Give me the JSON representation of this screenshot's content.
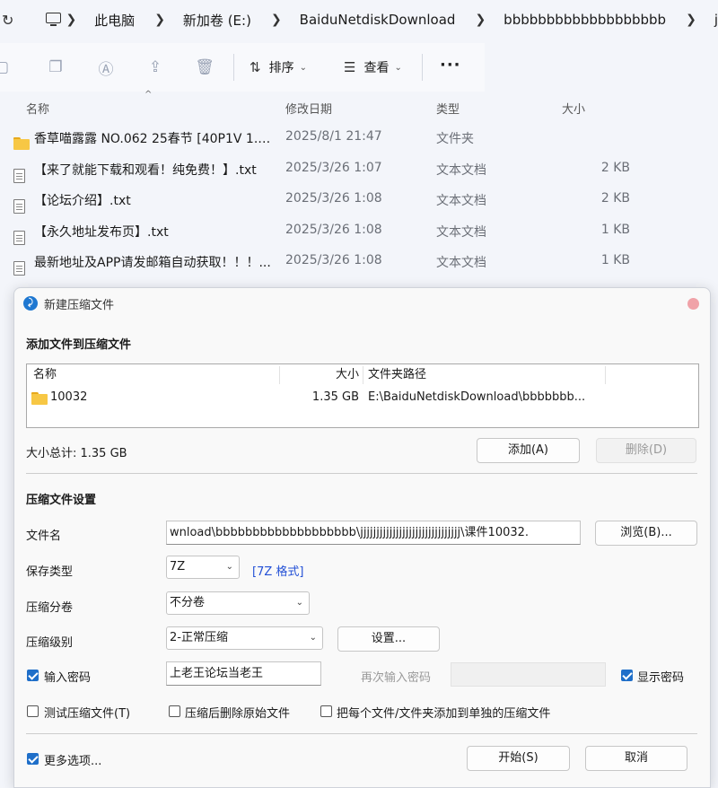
{
  "explorer": {
    "breadcrumb": [
      "此电脑",
      "新加卷 (E:)",
      "BaiduNetdiskDownload",
      "bbbbbbbbbbbbbbbbbbb",
      "j"
    ],
    "toolbar": {
      "sort_label": "排序",
      "view_label": "查看",
      "more_label": "···"
    },
    "columns": {
      "name": "名称",
      "date": "修改日期",
      "type": "类型",
      "size": "大小"
    },
    "files": [
      {
        "name": "香草喵露露 NO.062 25春节 [40P1V 1.3...",
        "date": "2025/8/1 21:47",
        "type": "文件夹",
        "size": "",
        "kind": "folder"
      },
      {
        "name": "【来了就能下载和观看！纯免费！】.txt",
        "date": "2025/3/26 1:07",
        "type": "文本文档",
        "size": "2 KB",
        "kind": "txt"
      },
      {
        "name": "【论坛介绍】.txt",
        "date": "2025/3/26 1:08",
        "type": "文本文档",
        "size": "2 KB",
        "kind": "txt"
      },
      {
        "name": "【永久地址发布页】.txt",
        "date": "2025/3/26 1:08",
        "type": "文本文档",
        "size": "1 KB",
        "kind": "txt"
      },
      {
        "name": "最新地址及APP请发邮箱自动获取！！！...",
        "date": "2025/3/26 1:08",
        "type": "文本文档",
        "size": "1 KB",
        "kind": "txt"
      }
    ]
  },
  "dialog": {
    "title": "新建压缩文件",
    "add_section_title": "添加文件到压缩文件",
    "table": {
      "col_name": "名称",
      "col_size": "大小",
      "col_path": "文件夹路径",
      "rows": [
        {
          "name": "10032",
          "size": "1.35 GB",
          "path": "E:\\BaiduNetdiskDownload\\bbbbbbb..."
        }
      ]
    },
    "total_size": "大小总计: 1.35 GB",
    "add_button": "添加(A)",
    "delete_button": "删除(D)",
    "settings_section_title": "压缩文件设置",
    "filename_label": "文件名",
    "filename_value": "wnload\\bbbbbbbbbbbbbbbbbbb\\jjjjjjjjjjjjjjjjjjjjjjjjjjjjjjj\\课件10032.",
    "browse_button": "浏览(B)...",
    "save_type_label": "保存类型",
    "save_type_value": "7Z",
    "format_link": "[7Z 格式]",
    "split_label": "压缩分卷",
    "split_value": "不分卷",
    "level_label": "压缩级别",
    "level_value": "2-正常压缩",
    "settings_button": "设置...",
    "password_label": "输入密码",
    "password_checked": true,
    "password_value": "上老王论坛当老王",
    "reenter_label": "再次输入密码",
    "show_password_label": "显示密码",
    "show_password_checked": true,
    "test_label": "测试压缩文件(T)",
    "delete_after_label": "压缩后删除原始文件",
    "separate_label": "把每个文件/文件夹添加到单独的压缩文件",
    "more_options_label": "更多选项...",
    "more_options_checked": true,
    "start_button": "开始(S)",
    "cancel_button": "取消"
  },
  "colors": {
    "accent": "#1f6fc9",
    "link": "#2451d6",
    "folder": "#f7c744",
    "close_dot": "#f0a2a8"
  }
}
